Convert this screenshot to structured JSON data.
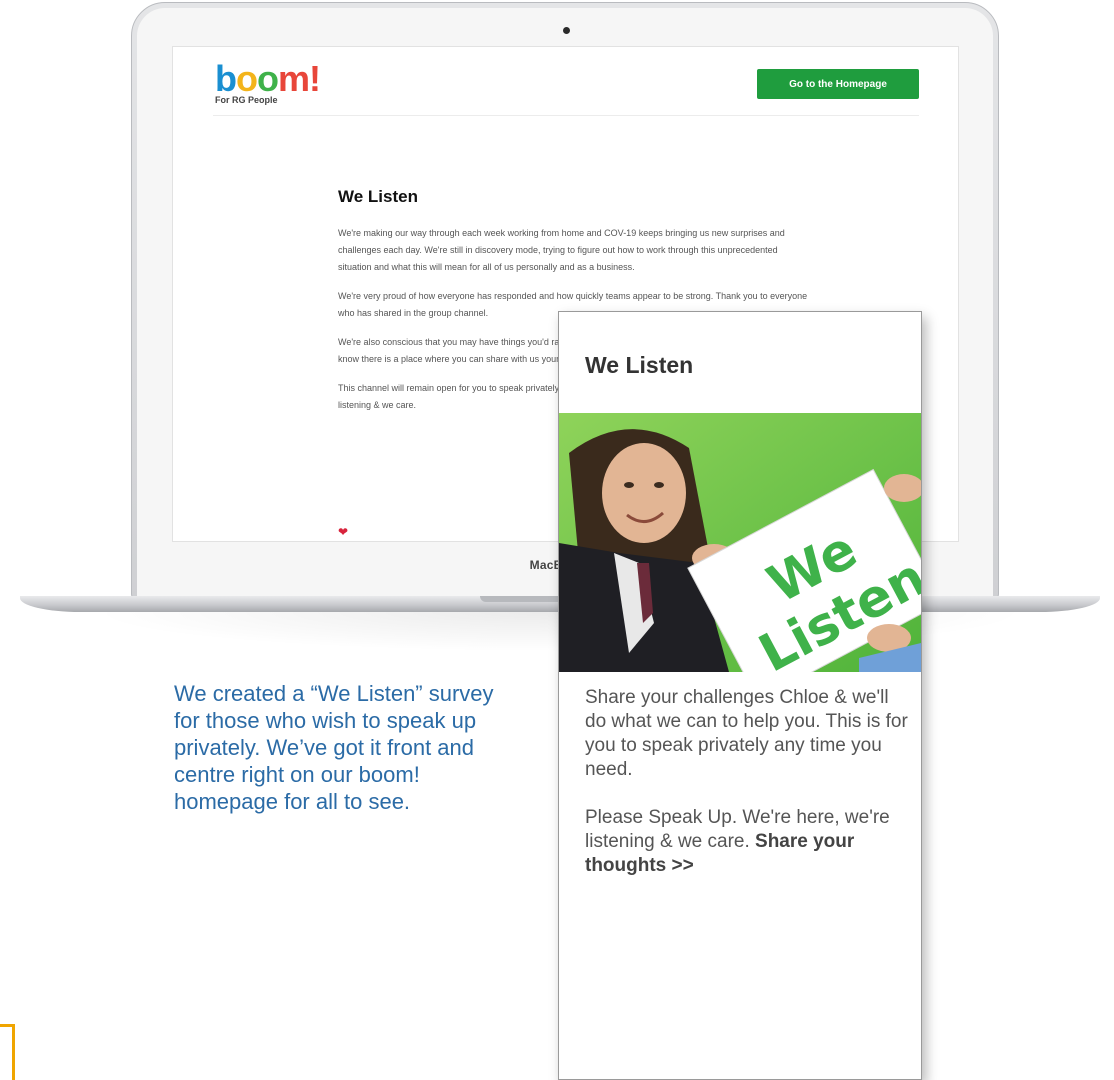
{
  "device": {
    "label": "MacBook"
  },
  "site": {
    "logo_text": "boom!",
    "logo_tagline": "For RG People",
    "home_button": "Go to the Homepage",
    "heading": "We Listen",
    "paragraphs": [
      "We're making our way through each week working from home and COV-19 keeps bringing us new surprises and challenges each day. We're still in discovery mode, trying to figure out how to work through this unprecedented situation and what this will mean for all of us personally and as a business.",
      "We're very proud of how everyone has responded and how quickly teams appear to be strong. Thank you to everyone who has shared in the group channel.",
      "We're also conscious that you may have things you'd rather not share in an open group channel. We want you to know there is a place where you can share with us your challenges and concerns.",
      "This channel will remain open for you to speak privately any time you need. Please Speak Up - We're here, we're listening & we care."
    ]
  },
  "caption": "We created a “We Listen” survey for those who wish to speak up privately. We’ve got it front and centre right on our boom! homepage for all to see.",
  "card": {
    "title": "We Listen",
    "image_sign_line1": "We",
    "image_sign_line2": "Listen",
    "text_para1": "Share your challenges Chloe & we'll do what we can to help you. This is for you to speak privately any time you need.",
    "text_para2_plain": "Please Speak Up. We're here, we're listening & we care.",
    "text_para2_link": "Share your thoughts >>"
  },
  "colors": {
    "accent_green": "#1f9d3e",
    "caption_blue": "#2b6ba6",
    "bracket_orange": "#f0a500"
  }
}
